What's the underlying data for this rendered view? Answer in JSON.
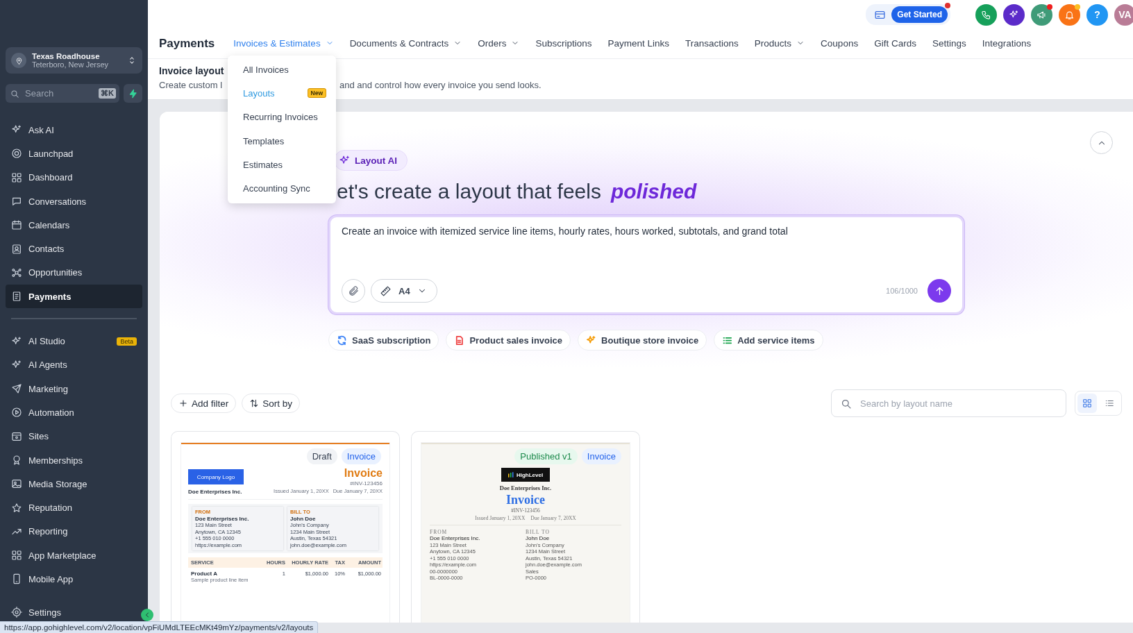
{
  "sidebar": {
    "location": {
      "name": "Texas Roadhouse",
      "address": "Teterboro, New Jersey"
    },
    "search": {
      "placeholder": "Search",
      "shortcut": "⌘K"
    },
    "items": [
      {
        "label": "Ask AI",
        "selected": false
      },
      {
        "label": "Launchpad",
        "selected": false
      },
      {
        "label": "Dashboard",
        "selected": false
      },
      {
        "label": "Conversations",
        "selected": false
      },
      {
        "label": "Calendars",
        "selected": false
      },
      {
        "label": "Contacts",
        "selected": false
      },
      {
        "label": "Opportunities",
        "selected": false
      },
      {
        "label": "Payments",
        "selected": true
      }
    ],
    "items_lower": [
      {
        "label": "AI Studio",
        "selected": false,
        "badge": "Beta"
      },
      {
        "label": "AI Agents",
        "selected": false
      },
      {
        "label": "Marketing",
        "selected": false
      },
      {
        "label": "Automation",
        "selected": false
      },
      {
        "label": "Sites",
        "selected": false
      },
      {
        "label": "Memberships",
        "selected": false
      },
      {
        "label": "Media Storage",
        "selected": false
      },
      {
        "label": "Reputation",
        "selected": false
      },
      {
        "label": "Reporting",
        "selected": false
      },
      {
        "label": "App Marketplace",
        "selected": false
      },
      {
        "label": "Mobile App",
        "selected": false
      }
    ],
    "settings": {
      "label": "Settings",
      "selected": false
    }
  },
  "header": {
    "title": "Payments",
    "get_started": "Get Started",
    "get_started_dot": {
      "color": "#e0302f"
    },
    "tabs": [
      {
        "label": "Invoices & Estimates",
        "selected": true,
        "has_menu": true
      },
      {
        "label": "Documents & Contracts",
        "selected": false,
        "has_menu": true
      },
      {
        "label": "Orders",
        "selected": false,
        "has_menu": true
      },
      {
        "label": "Subscriptions",
        "selected": false,
        "has_menu": false
      },
      {
        "label": "Payment Links",
        "selected": false,
        "has_menu": false
      },
      {
        "label": "Transactions",
        "selected": false,
        "has_menu": false
      },
      {
        "label": "Products",
        "selected": false,
        "has_menu": true
      },
      {
        "label": "Coupons",
        "selected": false,
        "has_menu": false
      },
      {
        "label": "Gift Cards",
        "selected": false,
        "has_menu": false
      },
      {
        "label": "Settings",
        "selected": false,
        "has_menu": false
      },
      {
        "label": "Integrations",
        "selected": false,
        "has_menu": false
      }
    ],
    "actions": [
      {
        "kind": "phone",
        "color": "#16a05a"
      },
      {
        "kind": "sparkles",
        "color": "#5b2bc9"
      },
      {
        "kind": "megaphone",
        "color": "#3f9b78",
        "dot": {
          "color": "#f01e1e"
        }
      },
      {
        "kind": "bell",
        "color": "#f97316",
        "dot": {
          "color": "#fbbf24"
        }
      },
      {
        "kind": "help",
        "color": "#2196f3",
        "label": "?"
      },
      {
        "kind": "avatar",
        "color": "#b97c96",
        "label": "VA"
      }
    ]
  },
  "menu": {
    "items": [
      {
        "label": "All Invoices",
        "selected": false
      },
      {
        "label": "Layouts",
        "selected": true,
        "badge": "New"
      },
      {
        "label": "Recurring Invoices",
        "selected": false
      },
      {
        "label": "Templates",
        "selected": false
      },
      {
        "label": "Estimates",
        "selected": false
      },
      {
        "label": "Accounting Sync",
        "selected": false
      }
    ]
  },
  "page": {
    "title": "Invoice layout",
    "subtitle_start": "Create custom l",
    "subtitle_end": "and and control how every invoice you send looks."
  },
  "hero": {
    "chip": "Layout AI",
    "heading": "et's create a layout that feels",
    "heading_accent": "polished",
    "prompt": {
      "value": "Create an invoice with itemized service line items, hourly rates, hours worked, subtotals, and grand total",
      "paper": "A4",
      "counter": "106/1000"
    },
    "suggestions": [
      {
        "label": "SaaS subscription",
        "color": "#3b82f6"
      },
      {
        "label": "Product sales invoice",
        "color": "#ef4444"
      },
      {
        "label": "Boutique store invoice",
        "color": "#f59e0b"
      },
      {
        "label": "Add service items",
        "color": "#16a34a"
      }
    ]
  },
  "toolbar": {
    "add_filter": "Add filter",
    "sort": "Sort by",
    "search": {
      "placeholder": "Search by layout name"
    },
    "views": [
      {
        "kind": "grid",
        "selected": true
      },
      {
        "kind": "list",
        "selected": false
      }
    ]
  },
  "layouts": [
    {
      "status": {
        "label": "Draft",
        "color": "#374151"
      },
      "type": "Invoice",
      "doc": {
        "logo": "Company Logo",
        "company": "Doe Enterprises Inc.",
        "title": "Invoice",
        "number": "#INV-123456",
        "issued": "Issued January 1, 20XX",
        "due": "Due January 7, 20XX",
        "from": {
          "label": "FROM",
          "name": "Doe Enterprises Inc.",
          "lines": [
            "123 Main Street",
            "Anytown, CA 12345",
            "+1 555 010 0000",
            "https://example.com"
          ]
        },
        "bill_to": {
          "label": "BILL TO",
          "name": "John Doe",
          "lines": [
            "John's Company",
            "1234 Main Street",
            "Austin, Texas 54321",
            "john.doe@example.com"
          ]
        },
        "table": {
          "columns": [
            "SERVICE",
            "HOURS",
            "HOURLY RATE",
            "TAX",
            "AMOUNT"
          ],
          "rows": [
            {
              "cells": [
                "Product A",
                "1",
                "$1,000.00",
                "10%",
                "$1,000.00"
              ],
              "note": "Sample product line item"
            }
          ]
        }
      }
    },
    {
      "status": {
        "label": "Published v1",
        "color": "#1d8a4c"
      },
      "type": "Invoice",
      "doc": {
        "logo": "HighLevel",
        "company": "Doe Enterprises Inc.",
        "title": "Invoice",
        "number": "#INV-123456",
        "issued": "Issued January 1, 20XX",
        "due": "Due January 7, 20XX",
        "from": {
          "label": "FROM",
          "name": "Doe Enterprises Inc.",
          "lines": [
            "123 Main Street",
            "Anytown, CA 12345",
            "+1 555 010 0000",
            "https://example.com",
            "00-0000000",
            "BL-0000-0000"
          ]
        },
        "bill_to": {
          "label": "BILL TO",
          "name": "John Doe",
          "lines": [
            "John's Company",
            "1234 Main Street",
            "Austin, Texas 54321",
            "john.doe@example.com",
            "Sales",
            "PO-0000"
          ]
        }
      }
    }
  ],
  "status_url": "https://app.gohighlevel.com/v2/location/vpFiUMdLTEEcMKt49mYz/payments/v2/layouts"
}
